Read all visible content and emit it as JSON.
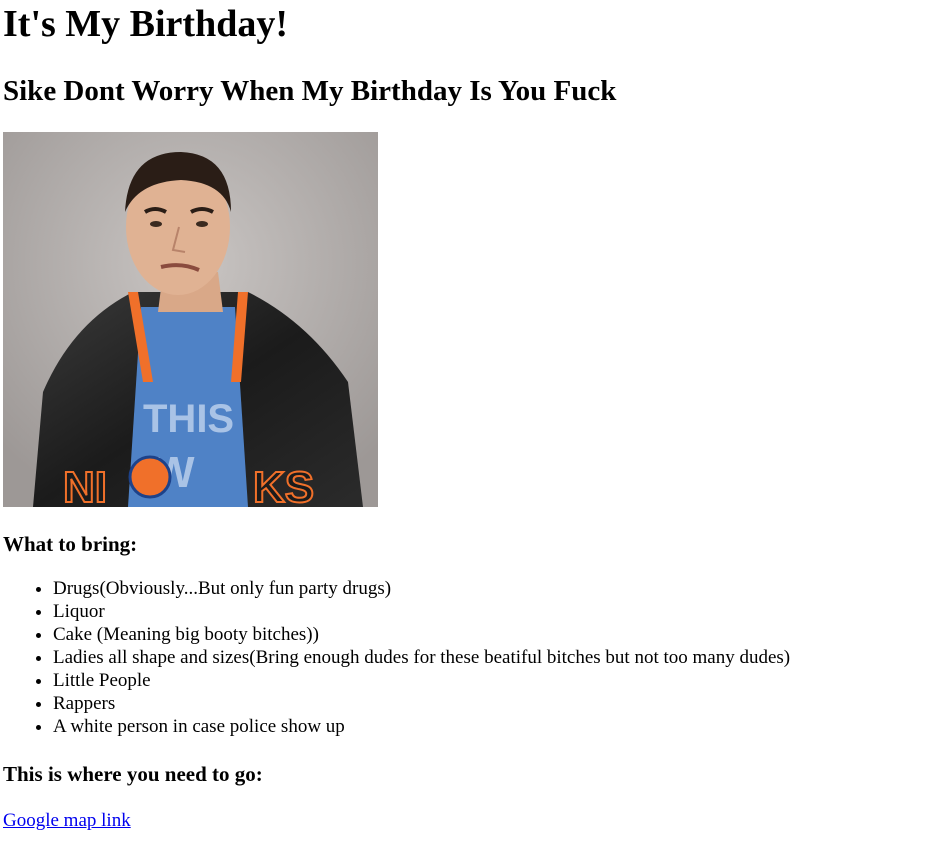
{
  "header": {
    "title": "It's My Birthday!",
    "subtitle": "Sike Dont Worry When My Birthday Is You Fuck"
  },
  "bring": {
    "heading": "What to bring:",
    "items": [
      "Drugs(Obviously...But only fun party drugs)",
      "Liquor",
      "Cake (Meaning big booty bitches))",
      "Ladies all shape and sizes(Bring enough dudes for these beatiful bitches but not too many dudes)",
      "Little People",
      "Rappers",
      "A white person in case police show up"
    ]
  },
  "location": {
    "heading": "This is where you need to go:",
    "link_text": "Google map link"
  },
  "colors": {
    "link": "#0000ee",
    "photo_backdrop": "#b5b0ae",
    "jacket": "#222222",
    "shirt": "#4f82c6",
    "knicks_orange": "#f0702a"
  }
}
